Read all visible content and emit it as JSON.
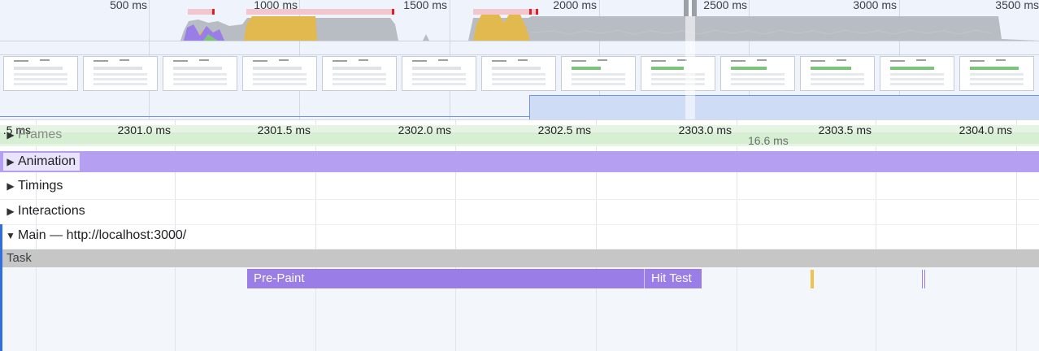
{
  "overview": {
    "time_labels": [
      "500 ms",
      "1000 ms",
      "1500 ms",
      "2000 ms",
      "2500 ms",
      "3000 ms",
      "3500 ms"
    ]
  },
  "ruler": {
    "labels": [
      ".5 ms",
      "2301.0 ms",
      "2301.5 ms",
      "2302.0 ms",
      "2302.5 ms",
      "2303.0 ms",
      "2303.5 ms",
      "2304.0 ms"
    ]
  },
  "tracks": {
    "frames": {
      "label": "Frames",
      "duration": "16.6 ms"
    },
    "animation": {
      "label": "Animation"
    },
    "timings": {
      "label": "Timings"
    },
    "interactions": {
      "label": "Interactions"
    },
    "main": {
      "label": "Main — http://localhost:3000/"
    }
  },
  "events": {
    "task": "Task",
    "prepaint": "Pre-Paint",
    "hittest": "Hit Test"
  },
  "colors": {
    "scripting": "#e2b94f",
    "rendering": "#9a7de6",
    "system": "#b8bcc3",
    "frames": "#d6efd3",
    "network": "#cfdcf6",
    "main_selected": "#2f6fdf"
  }
}
